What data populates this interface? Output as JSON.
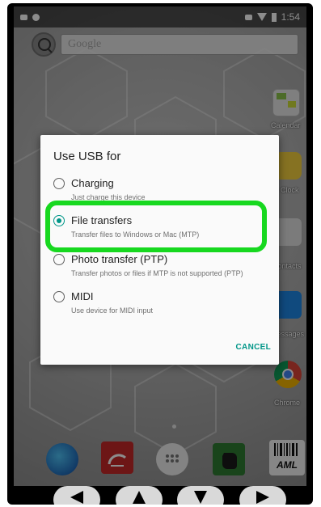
{
  "status_bar": {
    "time": "1:54"
  },
  "home": {
    "search_placeholder": "Google",
    "apps": {
      "calendar": "Calendar",
      "clock": "Clock",
      "contacts": "Contacts",
      "messages": "Messages",
      "chrome": "Chrome"
    }
  },
  "dialog": {
    "title": "Use USB for",
    "options": [
      {
        "label": "Charging",
        "description": "Just charge this device",
        "selected": false
      },
      {
        "label": "File transfers",
        "description": "Transfer files to Windows or Mac (MTP)",
        "selected": true
      },
      {
        "label": "Photo transfer (PTP)",
        "description": "Transfer photos or files if MTP is not supported (PTP)",
        "selected": false
      },
      {
        "label": "MIDI",
        "description": "Use device for MIDI input",
        "selected": false
      }
    ],
    "cancel_label": "CANCEL"
  },
  "dock": {
    "aml_label": "AML"
  },
  "colors": {
    "accent": "#009688",
    "highlight": "#17d81f"
  }
}
